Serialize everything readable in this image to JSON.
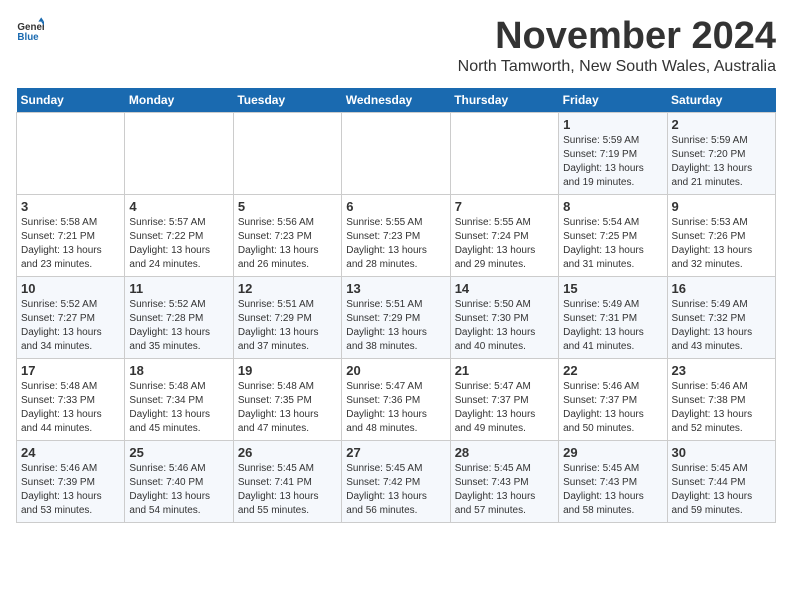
{
  "logo": {
    "general": "General",
    "blue": "Blue"
  },
  "title": "November 2024",
  "subtitle": "North Tamworth, New South Wales, Australia",
  "weekdays": [
    "Sunday",
    "Monday",
    "Tuesday",
    "Wednesday",
    "Thursday",
    "Friday",
    "Saturday"
  ],
  "weeks": [
    [
      {
        "day": "",
        "info": ""
      },
      {
        "day": "",
        "info": ""
      },
      {
        "day": "",
        "info": ""
      },
      {
        "day": "",
        "info": ""
      },
      {
        "day": "",
        "info": ""
      },
      {
        "day": "1",
        "info": "Sunrise: 5:59 AM\nSunset: 7:19 PM\nDaylight: 13 hours\nand 19 minutes."
      },
      {
        "day": "2",
        "info": "Sunrise: 5:59 AM\nSunset: 7:20 PM\nDaylight: 13 hours\nand 21 minutes."
      }
    ],
    [
      {
        "day": "3",
        "info": "Sunrise: 5:58 AM\nSunset: 7:21 PM\nDaylight: 13 hours\nand 23 minutes."
      },
      {
        "day": "4",
        "info": "Sunrise: 5:57 AM\nSunset: 7:22 PM\nDaylight: 13 hours\nand 24 minutes."
      },
      {
        "day": "5",
        "info": "Sunrise: 5:56 AM\nSunset: 7:23 PM\nDaylight: 13 hours\nand 26 minutes."
      },
      {
        "day": "6",
        "info": "Sunrise: 5:55 AM\nSunset: 7:23 PM\nDaylight: 13 hours\nand 28 minutes."
      },
      {
        "day": "7",
        "info": "Sunrise: 5:55 AM\nSunset: 7:24 PM\nDaylight: 13 hours\nand 29 minutes."
      },
      {
        "day": "8",
        "info": "Sunrise: 5:54 AM\nSunset: 7:25 PM\nDaylight: 13 hours\nand 31 minutes."
      },
      {
        "day": "9",
        "info": "Sunrise: 5:53 AM\nSunset: 7:26 PM\nDaylight: 13 hours\nand 32 minutes."
      }
    ],
    [
      {
        "day": "10",
        "info": "Sunrise: 5:52 AM\nSunset: 7:27 PM\nDaylight: 13 hours\nand 34 minutes."
      },
      {
        "day": "11",
        "info": "Sunrise: 5:52 AM\nSunset: 7:28 PM\nDaylight: 13 hours\nand 35 minutes."
      },
      {
        "day": "12",
        "info": "Sunrise: 5:51 AM\nSunset: 7:29 PM\nDaylight: 13 hours\nand 37 minutes."
      },
      {
        "day": "13",
        "info": "Sunrise: 5:51 AM\nSunset: 7:29 PM\nDaylight: 13 hours\nand 38 minutes."
      },
      {
        "day": "14",
        "info": "Sunrise: 5:50 AM\nSunset: 7:30 PM\nDaylight: 13 hours\nand 40 minutes."
      },
      {
        "day": "15",
        "info": "Sunrise: 5:49 AM\nSunset: 7:31 PM\nDaylight: 13 hours\nand 41 minutes."
      },
      {
        "day": "16",
        "info": "Sunrise: 5:49 AM\nSunset: 7:32 PM\nDaylight: 13 hours\nand 43 minutes."
      }
    ],
    [
      {
        "day": "17",
        "info": "Sunrise: 5:48 AM\nSunset: 7:33 PM\nDaylight: 13 hours\nand 44 minutes."
      },
      {
        "day": "18",
        "info": "Sunrise: 5:48 AM\nSunset: 7:34 PM\nDaylight: 13 hours\nand 45 minutes."
      },
      {
        "day": "19",
        "info": "Sunrise: 5:48 AM\nSunset: 7:35 PM\nDaylight: 13 hours\nand 47 minutes."
      },
      {
        "day": "20",
        "info": "Sunrise: 5:47 AM\nSunset: 7:36 PM\nDaylight: 13 hours\nand 48 minutes."
      },
      {
        "day": "21",
        "info": "Sunrise: 5:47 AM\nSunset: 7:37 PM\nDaylight: 13 hours\nand 49 minutes."
      },
      {
        "day": "22",
        "info": "Sunrise: 5:46 AM\nSunset: 7:37 PM\nDaylight: 13 hours\nand 50 minutes."
      },
      {
        "day": "23",
        "info": "Sunrise: 5:46 AM\nSunset: 7:38 PM\nDaylight: 13 hours\nand 52 minutes."
      }
    ],
    [
      {
        "day": "24",
        "info": "Sunrise: 5:46 AM\nSunset: 7:39 PM\nDaylight: 13 hours\nand 53 minutes."
      },
      {
        "day": "25",
        "info": "Sunrise: 5:46 AM\nSunset: 7:40 PM\nDaylight: 13 hours\nand 54 minutes."
      },
      {
        "day": "26",
        "info": "Sunrise: 5:45 AM\nSunset: 7:41 PM\nDaylight: 13 hours\nand 55 minutes."
      },
      {
        "day": "27",
        "info": "Sunrise: 5:45 AM\nSunset: 7:42 PM\nDaylight: 13 hours\nand 56 minutes."
      },
      {
        "day": "28",
        "info": "Sunrise: 5:45 AM\nSunset: 7:43 PM\nDaylight: 13 hours\nand 57 minutes."
      },
      {
        "day": "29",
        "info": "Sunrise: 5:45 AM\nSunset: 7:43 PM\nDaylight: 13 hours\nand 58 minutes."
      },
      {
        "day": "30",
        "info": "Sunrise: 5:45 AM\nSunset: 7:44 PM\nDaylight: 13 hours\nand 59 minutes."
      }
    ]
  ]
}
